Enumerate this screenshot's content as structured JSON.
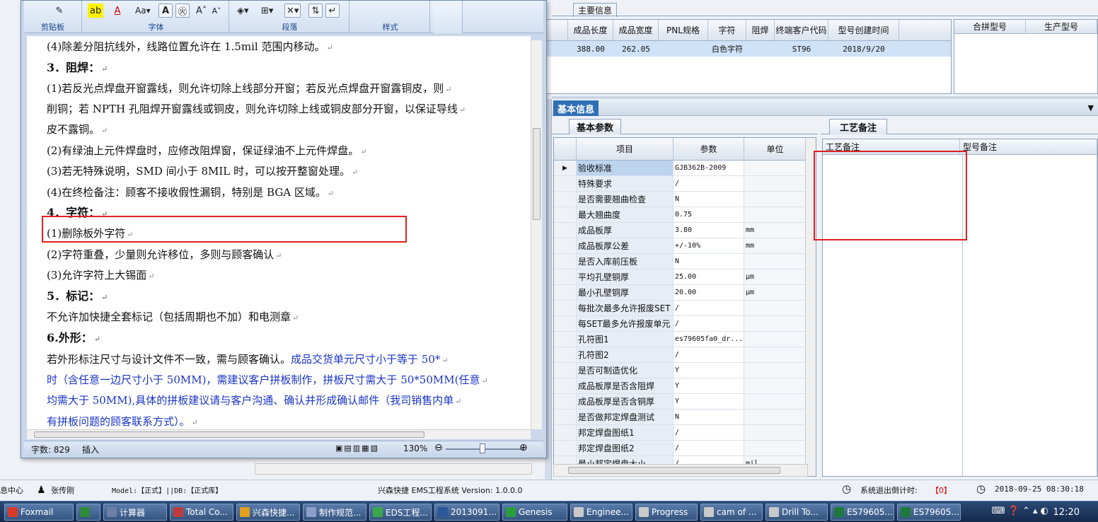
{
  "erp": {
    "main_info_tab": "主要信息",
    "top_columns": [
      "成品长度",
      "成品宽度",
      "PNL规格",
      "字符",
      "阻焊",
      "终端客户代码",
      "型号创建时间"
    ],
    "top_row": [
      "388.00",
      "262.05",
      "",
      "白色字符",
      "",
      "ST96",
      "2018/9/20"
    ],
    "side_columns": [
      "合拼型号",
      "生产型号"
    ],
    "basic_info_tab": "基本信息",
    "basic_params_tab": "基本参数",
    "params_columns": [
      "项目",
      "参数",
      "单位"
    ],
    "params_rows": [
      {
        "item": "验收标准",
        "value": "GJB362B-2009",
        "unit": ""
      },
      {
        "item": "特殊要求",
        "value": "/",
        "unit": ""
      },
      {
        "item": "是否需要翘曲检查",
        "value": "N",
        "unit": ""
      },
      {
        "item": "最大翘曲度",
        "value": "0.75",
        "unit": ""
      },
      {
        "item": "成品板厚",
        "value": "3.80",
        "unit": "mm"
      },
      {
        "item": "成品板厚公差",
        "value": "+/-10%",
        "unit": "mm"
      },
      {
        "item": "是否入库前压板",
        "value": "N",
        "unit": ""
      },
      {
        "item": "平均孔壁铜厚",
        "value": "25.00",
        "unit": "μm"
      },
      {
        "item": "最小孔壁铜厚",
        "value": "20.00",
        "unit": "μm"
      },
      {
        "item": "每批次最多允许报废SET",
        "value": "/",
        "unit": ""
      },
      {
        "item": "每SET最多允许报废单元",
        "value": "/",
        "unit": ""
      },
      {
        "item": "孔符图1",
        "value": "es79605fa0_dr...",
        "unit": ""
      },
      {
        "item": "孔符图2",
        "value": "/",
        "unit": ""
      },
      {
        "item": "是否可制造优化",
        "value": "Y",
        "unit": ""
      },
      {
        "item": "成品板厚是否含阻焊",
        "value": "Y",
        "unit": ""
      },
      {
        "item": "成品板厚是否含铜厚",
        "value": "Y",
        "unit": ""
      },
      {
        "item": "是否做邦定焊盘测试",
        "value": "N",
        "unit": ""
      },
      {
        "item": "邦定焊盘图纸1",
        "value": "/",
        "unit": ""
      },
      {
        "item": "邦定焊盘图纸2",
        "value": "/",
        "unit": ""
      },
      {
        "item": "最小邦定焊盘大小",
        "value": "/",
        "unit": "mil"
      }
    ],
    "craft_tab": "工艺备注",
    "craft_columns": [
      "工艺备注",
      "型号备注"
    ],
    "status": {
      "info_center": "息中心",
      "user": "张传刚",
      "model_db": "Model:【正式】||DB:【正式库】",
      "app_version": "兴森快捷 EMS工程系统 Version: 1.0.0.0",
      "logout_label": "系统退出倒计时:",
      "logout_value": "【0】",
      "datetime": "2018-09-25 08:30:18"
    }
  },
  "word": {
    "ribbon_groups": [
      "剪贴板",
      "字体",
      "段落",
      "样式"
    ],
    "lines": [
      {
        "t": "(4)除差分阻抗线外，线路位置允许在 1.5mil 范围内移动。",
        "s": ""
      },
      {
        "t": "3．阻焊：",
        "s": "b"
      },
      {
        "t": "(1)若反光点焊盘开窗露线，则允许切除上线部分开窗；若反光点焊盘开窗露铜皮，则",
        "s": ""
      },
      {
        "t": "削铜；若 NPTH 孔阻焊开窗露线或铜皮，则允许切除上线或铜皮部分开窗，以保证导线",
        "s": ""
      },
      {
        "t": "皮不露铜。",
        "s": ""
      },
      {
        "t": "(2)有绿油上元件焊盘时，应修改阻焊窗，保证绿油不上元件焊盘。",
        "s": ""
      },
      {
        "t": "(3)若无特殊说明，SMD 间小于 8MIL 时，可以按开整窗处理。",
        "s": ""
      },
      {
        "t": "(4)在终检备注：顾客不接收假性漏铜，特别是 BGA 区域。",
        "s": ""
      },
      {
        "t": "4．字符：",
        "s": "b"
      },
      {
        "t": "(1)删除板外字符",
        "s": ""
      },
      {
        "t": "(2)字符重叠，少量则允许移位，多则与顾客确认",
        "s": ""
      },
      {
        "t": "(3)允许字符上大锡面",
        "s": ""
      },
      {
        "t": "5．标记：",
        "s": "b"
      },
      {
        "t": "不允许加快捷全套标记（包括周期也不加）和电测章",
        "s": ""
      },
      {
        "t": "6.外形：",
        "s": "b"
      },
      {
        "t": "若外形标注尺寸与设计文件不一致，需与顾客确认。",
        "s": "mixed",
        "blue": "成品交货单元尺寸小于等于 50*"
      },
      {
        "t": "时（含任意一边尺寸小于 50MM)，需建议客户拼板制作，拼板尺寸需大于 50*50MM(任意",
        "s": "blue"
      },
      {
        "t": "均需大于 50MM),具体的拼板建议请与客户沟通、确认并形成确认邮件（我司销售内单",
        "s": "blue"
      },
      {
        "t": "有拼板问题的顾客联系方式）。",
        "s": "blue"
      }
    ],
    "status": {
      "words": "字数: 829",
      "mode": "插入",
      "zoom": "130%"
    }
  },
  "taskbar": {
    "items": [
      {
        "label": "Foxmail",
        "icon": "foxmail-icon",
        "color": "#d83a2a"
      },
      {
        "label": "",
        "icon": "app-icon",
        "color": "#2e8b3a"
      },
      {
        "label": "计算器",
        "icon": "calculator-icon",
        "color": "#6b7fa6"
      },
      {
        "label": "Total Co...",
        "icon": "floppy-icon",
        "color": "#c23b3b"
      },
      {
        "label": "兴森快捷...",
        "icon": "star-icon",
        "color": "#e0a020"
      },
      {
        "label": "制作规范...",
        "icon": "notepad-icon",
        "color": "#8aa0c8"
      },
      {
        "label": "EDS工程...",
        "icon": "eds-icon",
        "color": "#3aa84a"
      },
      {
        "label": "2013091...",
        "icon": "word-icon",
        "color": "#2b579a"
      },
      {
        "label": "Genesis",
        "icon": "genesis-icon",
        "color": "#2c9c3c"
      },
      {
        "label": "Enginee...",
        "icon": "excel-icon",
        "color": "#c9c9c9"
      },
      {
        "label": "Progress",
        "icon": "excel-icon",
        "color": "#c9c9c9"
      },
      {
        "label": "cam of ...",
        "icon": "excel-icon",
        "color": "#c9c9c9"
      },
      {
        "label": "Drill To...",
        "icon": "excel-icon",
        "color": "#c9c9c9"
      },
      {
        "label": "ES79605...",
        "icon": "excel-icon",
        "color": "#1d7a3a"
      },
      {
        "label": "ES79605...",
        "icon": "excel-icon",
        "color": "#1d7a3a"
      }
    ],
    "clock": "12:20"
  }
}
